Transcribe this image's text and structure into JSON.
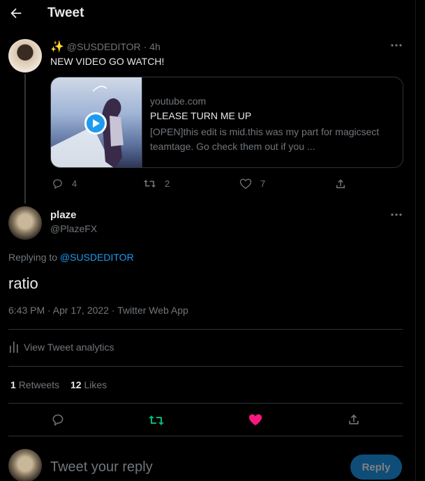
{
  "header": {
    "title": "Tweet"
  },
  "parent_tweet": {
    "emoji": "✨",
    "handle": "@SUSDEDITOR",
    "time": "· 4h",
    "text": "NEW VIDEO GO WATCH!",
    "card": {
      "domain": "youtube.com",
      "title": "PLEASE TURN ME UP",
      "description": "[OPEN]this edit is mid.this was my part for magicsect teamtage. Go check them out if you ..."
    },
    "replies": "4",
    "retweets": "2",
    "likes": "7"
  },
  "main_tweet": {
    "name": "plaze",
    "handle": "@PlazeFX",
    "replying_prefix": "Replying to",
    "replying_to": "@SUSDEDITOR",
    "text": "ratio",
    "meta": "6:43 PM · Apr 17, 2022 · Twitter Web App",
    "analytics": "View Tweet analytics",
    "retweet_count": "1",
    "retweet_label": "Retweets",
    "like_count": "12",
    "like_label": "Likes"
  },
  "reply_box": {
    "placeholder": "Tweet your reply",
    "button": "Reply"
  },
  "colors": {
    "accent": "#1d9bf0",
    "retweet_green": "#00ba7c",
    "like_pink": "#f91880",
    "muted": "#71767b"
  }
}
